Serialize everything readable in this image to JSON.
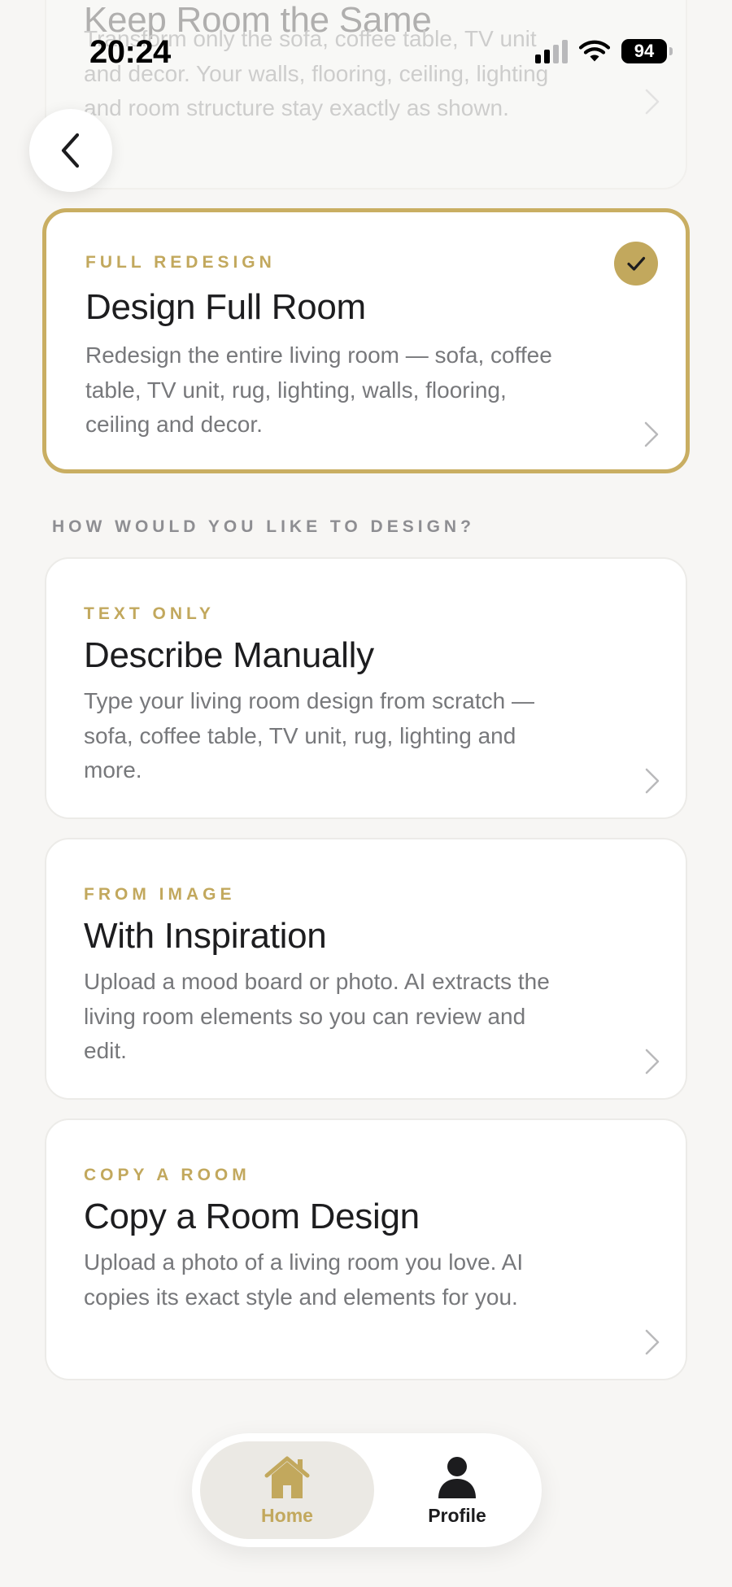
{
  "status_bar": {
    "time": "20:24",
    "battery": "94"
  },
  "colors": {
    "accent_gold": "#c2a85d",
    "selected_border": "#c9ae62",
    "background": "#f7f6f4",
    "muted_text": "#77787b"
  },
  "icons": {
    "back": "chevron-left-icon",
    "chevron": "chevron-right-icon",
    "check": "checkmark-icon",
    "home": "home-icon",
    "profile": "person-icon"
  },
  "faded_card": {
    "title": "Keep Room the Same",
    "description": "Transform only the sofa, coffee table, TV unit and decor. Your walls, flooring, ceiling, lighting and room structure stay exactly as shown."
  },
  "selected_card": {
    "eyebrow": "FULL REDESIGN",
    "title": "Design Full Room",
    "description": "Redesign the entire living room — sofa, coffee table, TV unit, rug, lighting, walls, flooring, ceiling and decor.",
    "selected": true
  },
  "section": {
    "label": "HOW WOULD YOU LIKE TO DESIGN?"
  },
  "options": [
    {
      "eyebrow": "TEXT ONLY",
      "title": "Describe Manually",
      "description": "Type your living room design from scratch — sofa, coffee table, TV unit, rug, lighting and more."
    },
    {
      "eyebrow": "FROM IMAGE",
      "title": "With Inspiration",
      "description": "Upload a mood board or photo. AI extracts the living room elements so you can review and edit."
    },
    {
      "eyebrow": "COPY A ROOM",
      "title": "Copy a Room Design",
      "description": "Upload a photo of a living room you love. AI copies its exact style and elements for you."
    }
  ],
  "tab_bar": {
    "home_label": "Home",
    "profile_label": "Profile",
    "active": "Home"
  }
}
